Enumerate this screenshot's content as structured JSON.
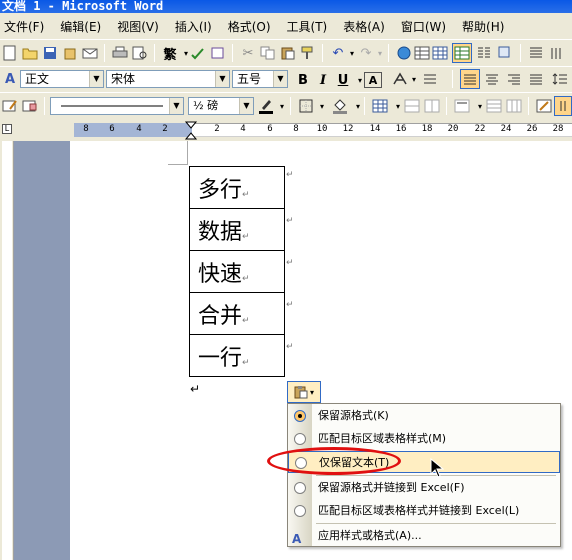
{
  "window": {
    "title": "文档 1 - Microsoft Word"
  },
  "menubar": {
    "items": [
      "文件(F)",
      "编辑(E)",
      "视图(V)",
      "插入(I)",
      "格式(O)",
      "工具(T)",
      "表格(A)",
      "窗口(W)",
      "帮助(H)"
    ]
  },
  "toolbar": {
    "traditional_label": "繁",
    "style_value": "正文",
    "font_value": "宋体",
    "size_value": "五号",
    "bold_label": "B",
    "italic_label": "I",
    "underline_label": "U",
    "char_border_label": "A",
    "line_weight_value": "½ 磅"
  },
  "ruler": {
    "labels": [
      "8",
      "6",
      "4",
      "2",
      "2",
      "4",
      "6",
      "8",
      "10",
      "12",
      "14",
      "16",
      "18",
      "20",
      "22",
      "24",
      "26",
      "28"
    ]
  },
  "table": {
    "rows": [
      "多行",
      "数据",
      "快速",
      "合并",
      "一行"
    ]
  },
  "paste_menu": {
    "items": [
      {
        "label": "保留源格式(K)",
        "selected": true
      },
      {
        "label": "匹配目标区域表格样式(M)",
        "selected": false
      },
      {
        "label": "仅保留文本(T)",
        "selected": false,
        "highlighted": true
      },
      {
        "label": "保留源格式并链接到 Excel(F)",
        "selected": false
      },
      {
        "label": "匹配目标区域表格样式并链接到 Excel(L)",
        "selected": false
      },
      {
        "label": "应用样式或格式(A)...",
        "selected": false
      }
    ]
  },
  "colors": {
    "title_bar": "#0a58e6",
    "highlight": "#ffeec2",
    "annotation_oval": "#e01010"
  }
}
